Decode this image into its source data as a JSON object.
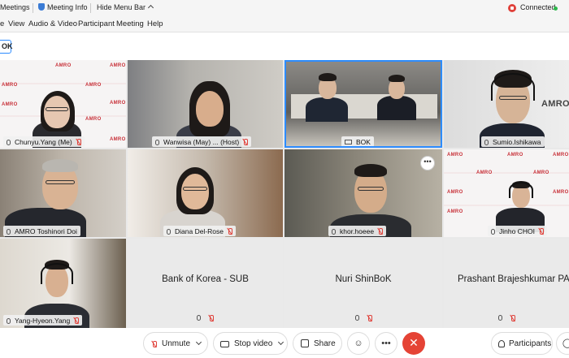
{
  "topbar": {
    "meetings": "Meetings",
    "meeting_info": "Meeting Info",
    "hide_menu_bar": "Hide Menu Bar",
    "connected": "Connected"
  },
  "menu": [
    "e",
    "View",
    "Audio & Video",
    "Participant",
    "Meeting",
    "Help"
  ],
  "active_badge": "OK",
  "tiles": [
    {
      "name": "Chunyu.Yang",
      "suffix": "(Me)"
    },
    {
      "name": "Wanwisa (May) ...",
      "suffix": "(Host)"
    },
    {
      "name": "BOK",
      "suffix": ""
    },
    {
      "name": "Sumio.Ishikawa",
      "suffix": ""
    },
    {
      "name": "AMRO Toshinori Doi",
      "suffix": ""
    },
    {
      "name": "Diana Del-Rose",
      "suffix": ""
    },
    {
      "name": "khor.hoeee",
      "suffix": ""
    },
    {
      "name": "Jinho CHOI",
      "suffix": ""
    },
    {
      "name": "Yang-Hyeon.Yang",
      "suffix": ""
    }
  ],
  "audio_only": [
    {
      "name": "Bank of Korea - SUB"
    },
    {
      "name": "Nuri ShinBoK"
    },
    {
      "name": "Prashant Brajeshkumar PAN"
    }
  ],
  "backdrop_text": "AMRO",
  "controls": {
    "unmute": "Unmute",
    "stop_video": "Stop video",
    "share": "Share",
    "participants": "Participants"
  },
  "colors": {
    "accent": "#2d8cff",
    "danger": "#e54335",
    "connected": "#2db84b"
  }
}
